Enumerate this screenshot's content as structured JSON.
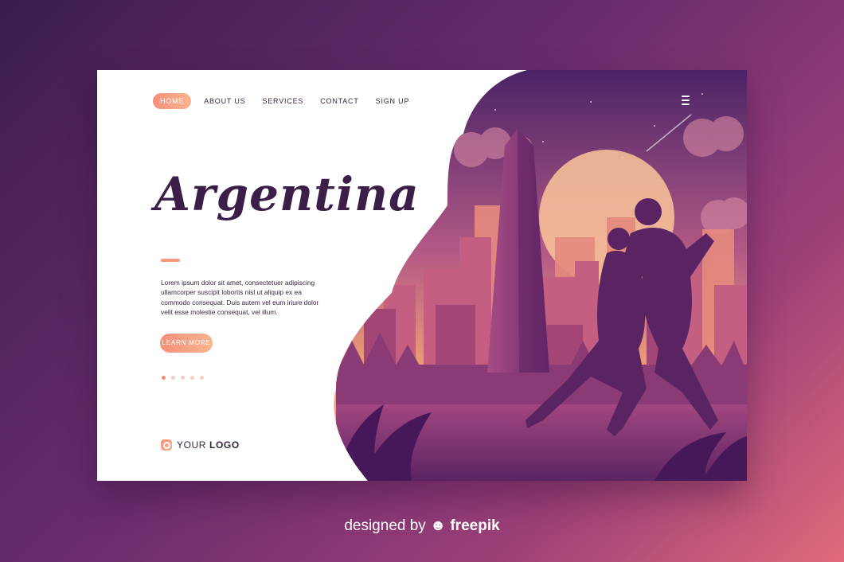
{
  "nav": {
    "items": [
      {
        "label": "HOME",
        "active": true
      },
      {
        "label": "ABOUT US",
        "active": false
      },
      {
        "label": "SERVICES",
        "active": false
      },
      {
        "label": "CONTACT",
        "active": false
      },
      {
        "label": "SIGN UP",
        "active": false
      }
    ],
    "menu_icon": "hamburger-menu-icon"
  },
  "hero": {
    "title": "Argentina",
    "body": "Lorem ipsum dolor sit amet, consectetuer adipiscing ullamcorper suscipit lobortis nisl ut aliquip ex ea commodo consequat. Duis autem vel eum iriure dolor velit esse molestie consequat, vel illum.",
    "cta_label": "LEARN MORE"
  },
  "carousel": {
    "count": 5,
    "active_index": 0
  },
  "logo": {
    "prefix": "YOUR",
    "bold": "LOGO",
    "icon": "camera-logo-icon"
  },
  "credit": {
    "prefix": "designed by",
    "brand": "freepik"
  },
  "colors": {
    "accent": "#f58f7a",
    "text": "#3a2440",
    "title": "#3b1f48"
  }
}
